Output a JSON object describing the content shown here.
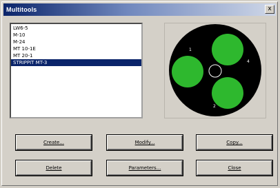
{
  "window": {
    "title": "Multitools",
    "close_label": "x"
  },
  "tool_list": {
    "items": [
      {
        "label": "LW6-5"
      },
      {
        "label": "M-10"
      },
      {
        "label": "M-24"
      },
      {
        "label": "MT 10-1E"
      },
      {
        "label": "MT 20-1"
      },
      {
        "label": "STRIPPIT MT-3",
        "selected": true
      }
    ]
  },
  "preview": {
    "station_numbers": [
      "1",
      "4",
      "2"
    ],
    "colors": {
      "disc": "#000000",
      "station": "#2eb82e",
      "guide": "#ffffff"
    }
  },
  "buttons": {
    "create": "Create...",
    "modify": "Modify...",
    "copy": "Copy...",
    "delete": "Delete",
    "parameters": "Parameters...",
    "close": "Close"
  }
}
